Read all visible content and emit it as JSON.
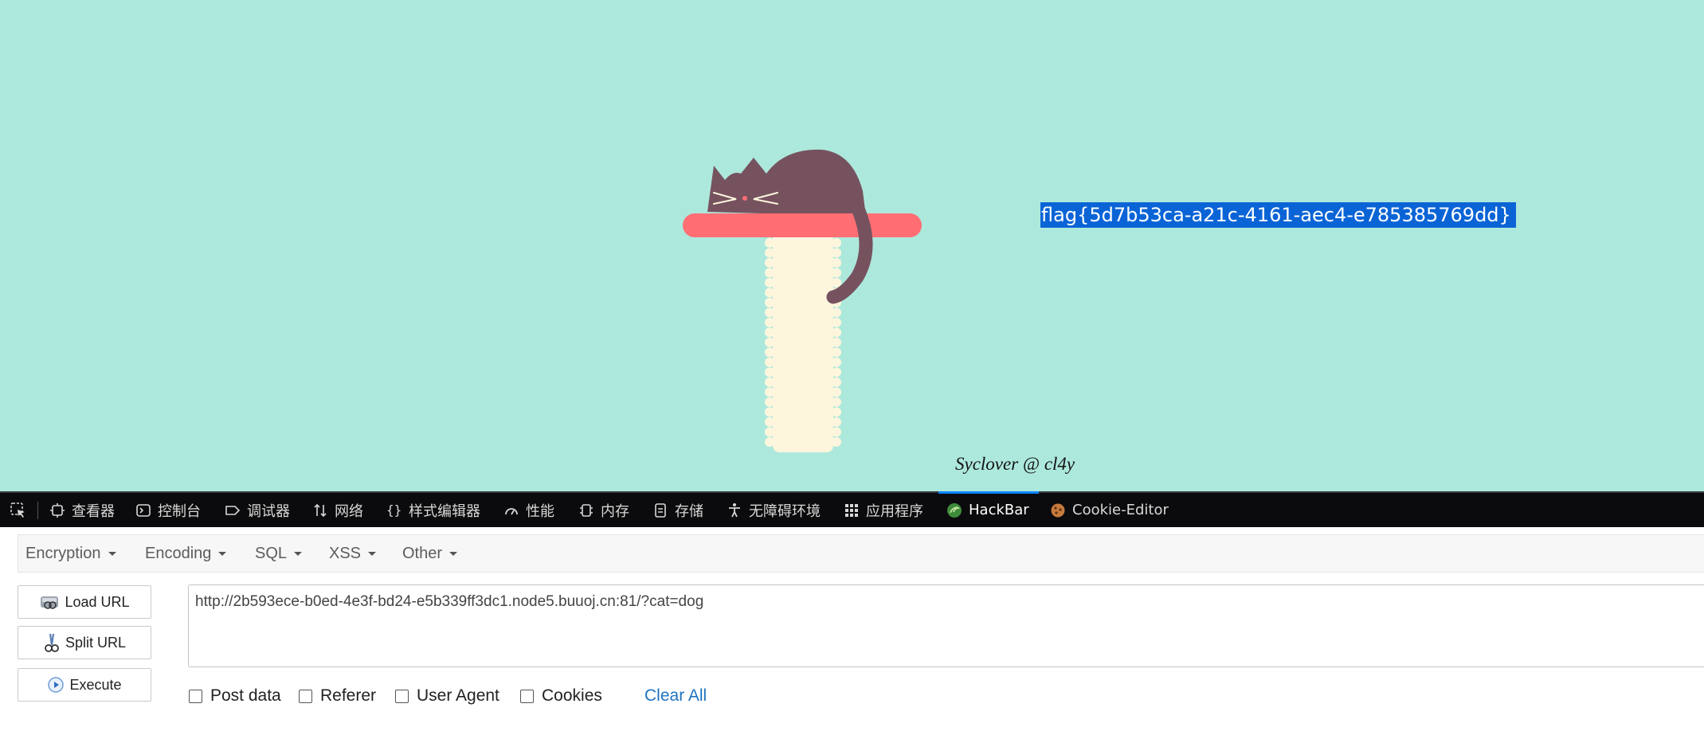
{
  "page": {
    "flag_text": "flag{5d7b53ca-a21c-4161-aec4-e785385769dd}",
    "credit": "Syclover @ cl4y",
    "colors": {
      "background": "#ade8dc",
      "cat": "#76525f",
      "perch": "#ff6e73",
      "post": "#fdf6dd",
      "selection": "#0a64d6"
    }
  },
  "devtools": {
    "tabs": [
      {
        "label": "查看器",
        "icon": "inspector-icon"
      },
      {
        "label": "控制台",
        "icon": "console-icon"
      },
      {
        "label": "调试器",
        "icon": "debugger-icon"
      },
      {
        "label": "网络",
        "icon": "network-icon"
      },
      {
        "label": "样式编辑器",
        "icon": "style-editor-icon"
      },
      {
        "label": "性能",
        "icon": "performance-icon"
      },
      {
        "label": "内存",
        "icon": "memory-icon"
      },
      {
        "label": "存储",
        "icon": "storage-icon"
      },
      {
        "label": "无障碍环境",
        "icon": "accessibility-icon"
      },
      {
        "label": "应用程序",
        "icon": "application-icon"
      },
      {
        "label": "HackBar",
        "icon": "hackbar-icon",
        "active": true
      },
      {
        "label": "Cookie-Editor",
        "icon": "cookie-icon"
      }
    ]
  },
  "hackbar": {
    "menu": [
      "Encryption",
      "Encoding",
      "SQL",
      "XSS",
      "Other"
    ],
    "buttons": {
      "load_url": "Load URL",
      "split_url": "Split URL",
      "execute": "Execute"
    },
    "url_value": "http://2b593ece-b0ed-4e3f-bd24-e5b339ff3dc1.node5.buuoj.cn:81/?cat=dog",
    "options": [
      "Post data",
      "Referer",
      "User Agent",
      "Cookies"
    ],
    "clear_all": "Clear All"
  }
}
